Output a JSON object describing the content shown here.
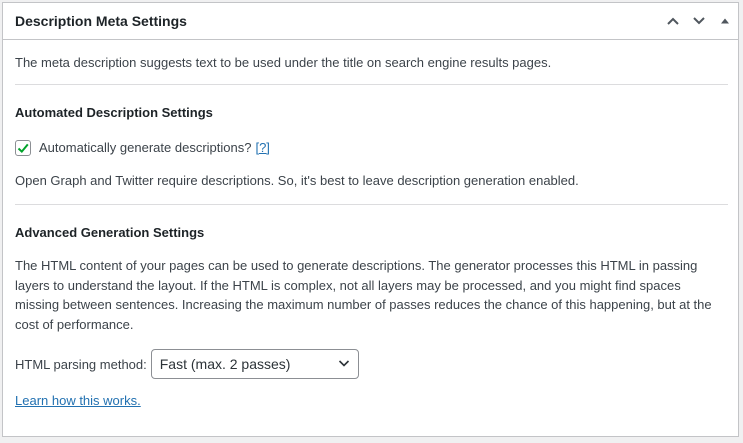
{
  "postbox": {
    "title": "Description Meta Settings",
    "actions": [
      {
        "name": "move-up-icon"
      },
      {
        "name": "move-down-icon"
      },
      {
        "name": "toggle-panel-icon"
      }
    ]
  },
  "intro": {
    "text": "The meta description suggests text to be used under the title on search engine results pages."
  },
  "automated": {
    "heading": "Automated Description Settings",
    "checkbox_label": "Automatically generate descriptions?",
    "checkbox_checked": true,
    "help_link": "[?]",
    "note": "Open Graph and Twitter require descriptions. So, it's best to leave description generation enabled."
  },
  "advanced": {
    "heading": "Advanced Generation Settings",
    "paragraph": "The HTML content of your pages can be used to generate descriptions. The generator processes this HTML in passing layers to understand the layout. If the HTML is complex, not all layers may be processed, and you might find spaces missing between sentences. Increasing the maximum number of passes reduces the chance of this happening, but at the cost of performance.",
    "select_label": "HTML parsing method:",
    "select_value": "Fast (max. 2 passes)",
    "learn_link": "Learn how this works."
  },
  "colors": {
    "accent": "#2271b1",
    "check": "#00a32a",
    "border": "#c3c4c7"
  }
}
